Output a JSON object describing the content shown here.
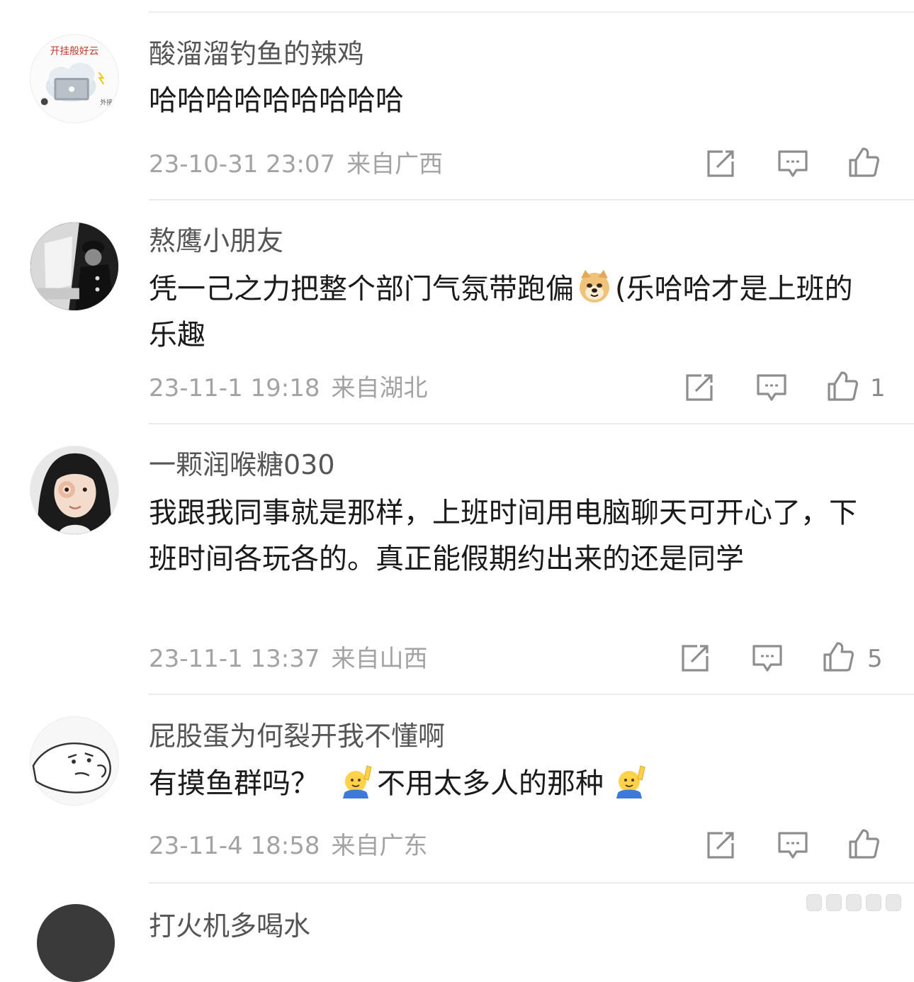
{
  "comments": [
    {
      "username": "酸溜溜钓鱼的辣鸡",
      "text": "哈哈哈哈哈哈哈哈哈",
      "time": "23-10-31 23:07",
      "location": "来自广西",
      "likes": "",
      "avatar_text": "开挂般好云",
      "avatar_sub": "外接"
    },
    {
      "username": "熬鹰小朋友",
      "text_before": "凭一己之力把整个部门气氛带跑偏",
      "text_after": "(乐哈哈才是上班的乐趣",
      "time": "23-11-1 19:18",
      "location": "来自湖北",
      "likes": "1"
    },
    {
      "username": "一颗润喉糖030",
      "text": "我跟我同事就是那样，上班时间用电脑聊天可开心了，下班时间各玩各的。真正能假期约出来的还是同学",
      "time": "23-11-1 13:37",
      "location": "来自山西",
      "likes": "5"
    },
    {
      "username": "屁股蛋为何裂开我不懂啊",
      "text_part1": "有摸鱼群吗？",
      "text_part2": "不用太多人的那种",
      "time": "23-11-4 18:58",
      "location": "来自广东",
      "likes": ""
    }
  ],
  "partial_username": "打火机多喝水",
  "icons": {
    "share": "share-icon",
    "comment": "comment-icon",
    "like": "thumbs-up-icon",
    "doge": "doge-emoji-icon",
    "raise_hand": "raise-hand-emoji-icon"
  },
  "colors": {
    "text": "#1a1a1a",
    "username": "#555555",
    "meta": "#a3a3a3",
    "divider": "#ececec"
  }
}
